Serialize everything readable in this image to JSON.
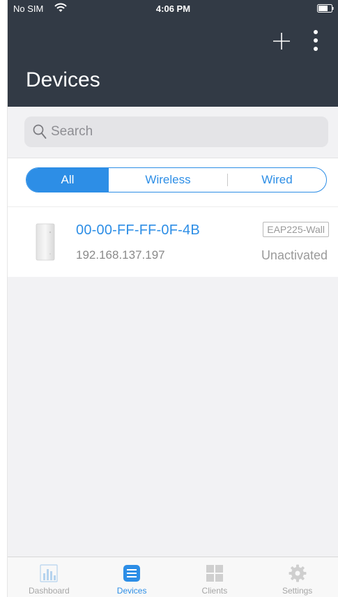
{
  "status_bar": {
    "carrier": "No SIM",
    "time": "4:06 PM"
  },
  "header": {
    "title": "Devices",
    "add_icon": "plus-icon",
    "more_icon": "more-vertical-icon"
  },
  "search": {
    "placeholder": "Search"
  },
  "filters": {
    "tabs": [
      "All",
      "Wireless",
      "Wired"
    ],
    "selected": "All"
  },
  "devices": [
    {
      "name": "00-00-FF-FF-0F-4B",
      "ip": "192.168.137.197",
      "model": "EAP225-Wall",
      "status": "Unactivated"
    }
  ],
  "tabbar": {
    "items": [
      {
        "label": "Dashboard",
        "icon": "bar-chart-icon"
      },
      {
        "label": "Devices",
        "icon": "list-icon"
      },
      {
        "label": "Clients",
        "icon": "grid-icon"
      },
      {
        "label": "Settings",
        "icon": "gear-icon"
      }
    ],
    "active": "Devices"
  },
  "colors": {
    "header_bg": "#323a45",
    "accent": "#2d8ee6",
    "inactive_tab": "#a6a6a6"
  }
}
